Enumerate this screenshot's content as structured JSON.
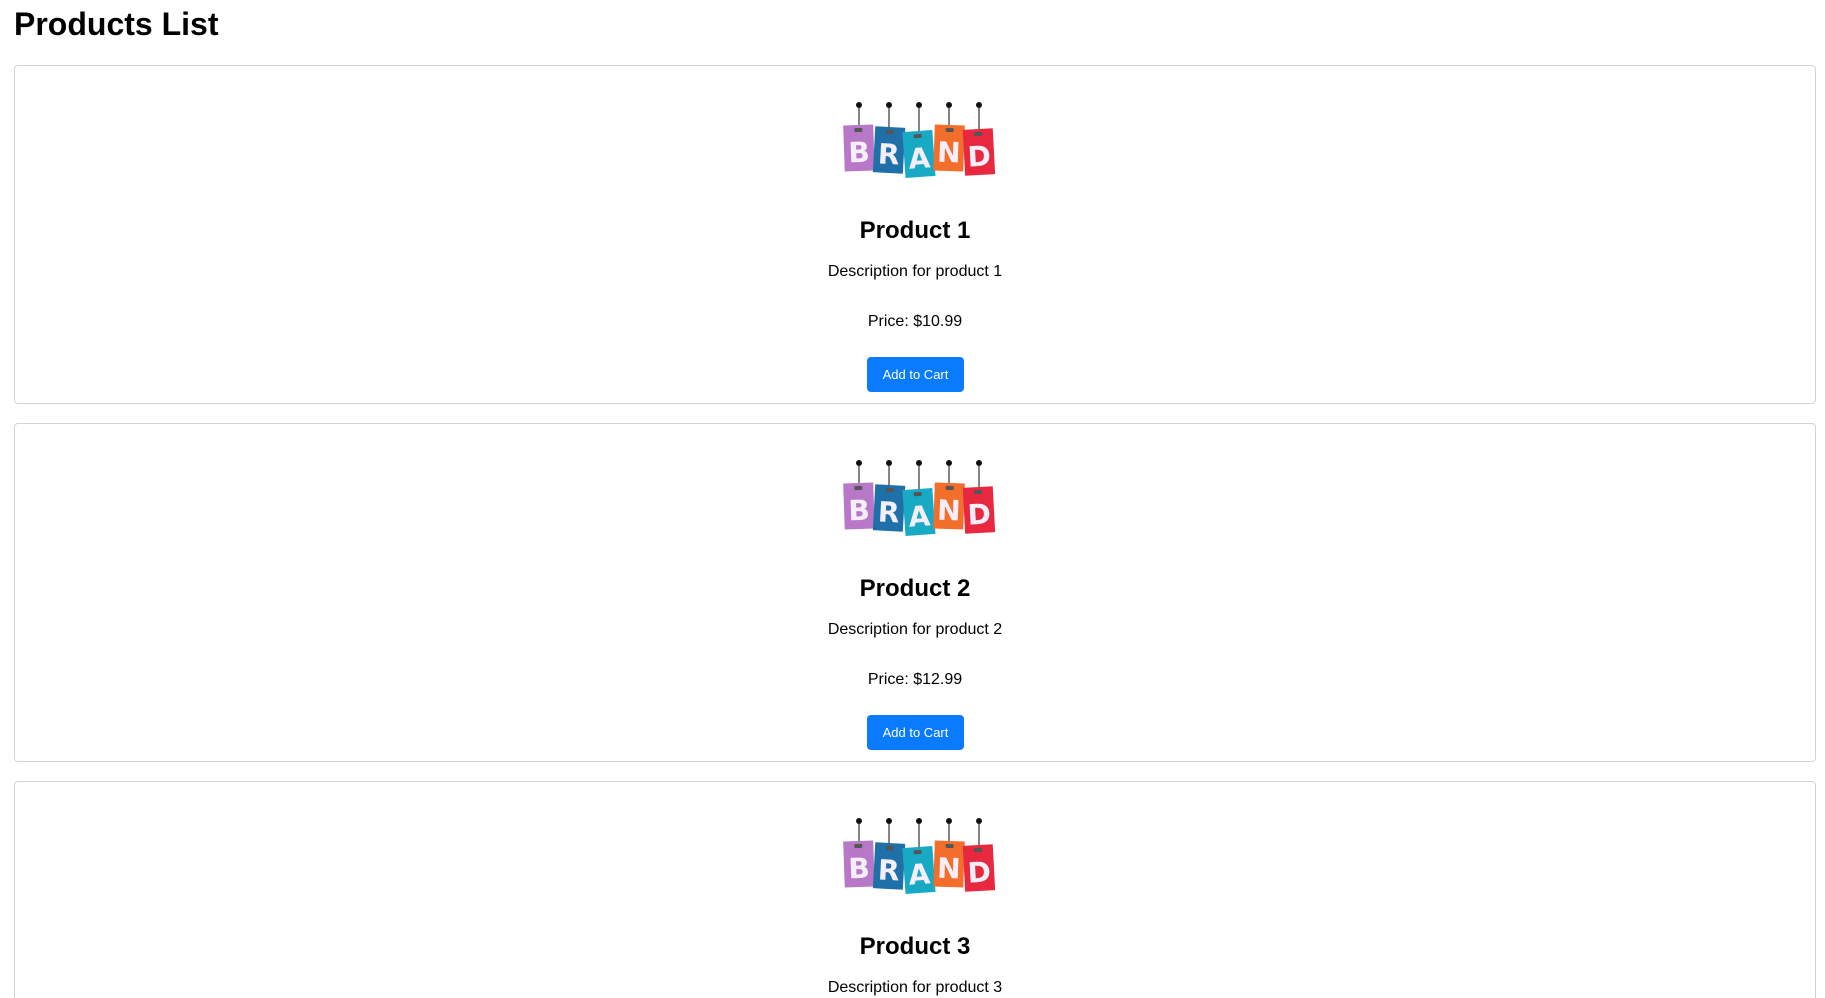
{
  "page": {
    "title": "Products List"
  },
  "products": [
    {
      "logo_text": "BRAND",
      "name": "Product 1",
      "description": "Description for product 1",
      "price_text": "Price: $10.99",
      "button_label": "Add to Cart"
    },
    {
      "logo_text": "BRAND",
      "name": "Product 2",
      "description": "Description for product 2",
      "price_text": "Price: $12.99",
      "button_label": "Add to Cart"
    },
    {
      "logo_text": "BRAND",
      "name": "Product 3",
      "description": "Description for product 3"
    }
  ],
  "colors": {
    "button": "#0a7bff",
    "logo_tags": [
      "#b878c8",
      "#1f6fa8",
      "#18a9c4",
      "#f36d2b",
      "#e8283f"
    ]
  },
  "icons": {
    "logo": "brand-hanging-tags-logo"
  }
}
